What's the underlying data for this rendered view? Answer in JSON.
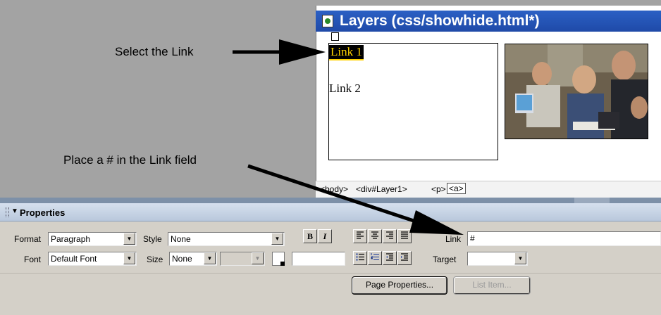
{
  "annotations": {
    "select_link": "Select the Link",
    "place_hash": "Place a # in the Link field"
  },
  "document_window": {
    "title": "Layers (css/showhide.html*)",
    "layer_links": [
      "Link 1",
      "Link 2"
    ],
    "photo_description_icon": "photo-of-people-at-computers",
    "tag_selector": [
      "<body>",
      "<div#Layer1>",
      "<p>",
      "<a>"
    ]
  },
  "properties_panel": {
    "title": "Properties",
    "format_label": "Format",
    "format_value": "Paragraph",
    "style_label": "Style",
    "style_value": "None",
    "bold_label": "B",
    "italic_label": "I",
    "link_label": "Link",
    "link_value": "#",
    "font_label": "Font",
    "font_value": "Default Font",
    "size_label": "Size",
    "size_value": "None",
    "target_label": "Target",
    "target_value": "",
    "page_properties_label": "Page Properties...",
    "list_item_label": "List Item..."
  },
  "colors": {
    "title_bar": "#2b60c4",
    "selection_highlight": "#ffd200",
    "panel_bg": "#d4d0c8",
    "backdrop": "#a3a3a3"
  }
}
